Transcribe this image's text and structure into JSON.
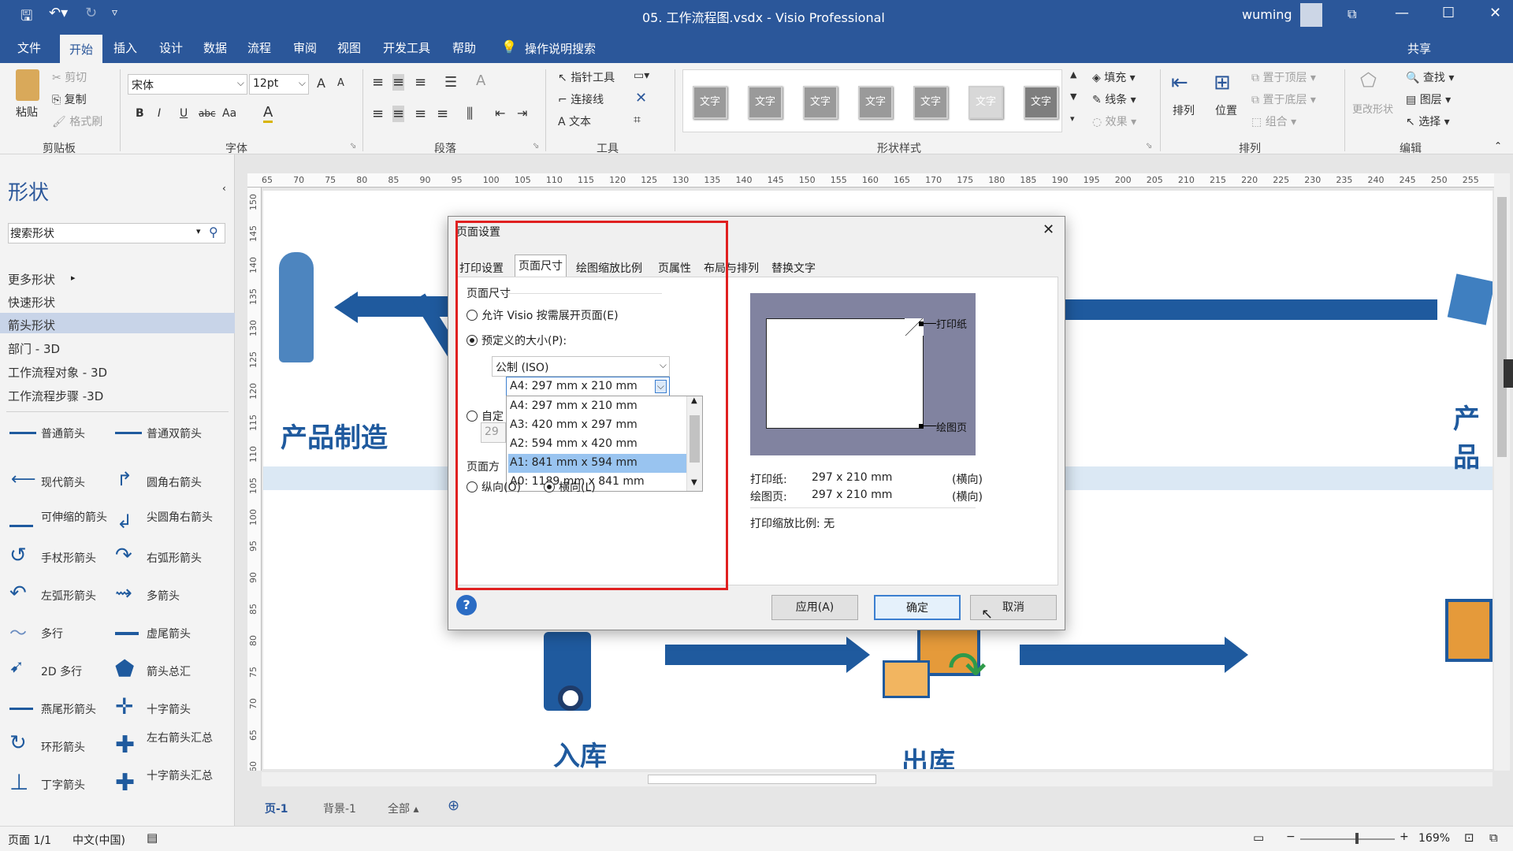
{
  "window": {
    "title": "05. 工作流程图.vsdx  -  Visio Professional",
    "user": "wuming",
    "share": "共享"
  },
  "tabs": [
    "文件",
    "开始",
    "插入",
    "设计",
    "数据",
    "流程",
    "审阅",
    "视图",
    "开发工具",
    "帮助"
  ],
  "tell_me": "操作说明搜索",
  "ribbon": {
    "clipboard": {
      "paste": "粘贴",
      "cut": "剪切",
      "copy": "复制",
      "format_painter": "格式刷",
      "label": "剪贴板"
    },
    "font": {
      "name": "宋体",
      "size": "12pt",
      "bold": "B",
      "italic": "I",
      "underline": "U",
      "strike": "abc",
      "case": "Aa",
      "grow": "A",
      "shrink": "A",
      "color": "A",
      "label": "字体"
    },
    "paragraph": {
      "label": "段落"
    },
    "tools": {
      "pointer": "指针工具",
      "connector": "连接线",
      "text": "文本",
      "label": "工具"
    },
    "styles": {
      "swatch": "文字",
      "fill": "填充",
      "line": "线条",
      "effect": "效果",
      "label": "形状样式"
    },
    "arrange": {
      "arrange": "排列",
      "position": "位置",
      "front": "置于顶层",
      "back": "置于底层",
      "group": "组合",
      "label": "排列"
    },
    "edit": {
      "change_shape": "更改形状",
      "find": "查找",
      "layers": "图层",
      "select": "选择",
      "label": "编辑"
    }
  },
  "shapes_panel": {
    "title": "形状",
    "search_placeholder": "搜索形状",
    "categories": [
      "更多形状",
      "快速形状",
      "箭头形状",
      "部门 - 3D",
      "工作流程对象 - 3D",
      "工作流程步骤 -3D"
    ],
    "items": [
      [
        "普通箭头",
        "普通双箭头"
      ],
      [
        "现代箭头",
        "圆角右箭头"
      ],
      [
        "可伸缩的箭头",
        "尖圆角右箭头"
      ],
      [
        "手杖形箭头",
        "右弧形箭头"
      ],
      [
        "左弧形箭头",
        "多箭头"
      ],
      [
        "多行",
        "虚尾箭头"
      ],
      [
        "2D 多行",
        "箭头总汇"
      ],
      [
        "燕尾形箭头",
        "十字箭头"
      ],
      [
        "环形箭头",
        "左右箭头汇总"
      ],
      [
        "丁字箭头",
        "十字箭头汇总"
      ]
    ]
  },
  "ruler_top": [
    "65",
    "70",
    "75",
    "80",
    "85",
    "90",
    "95",
    "100",
    "105",
    "110",
    "115",
    "120",
    "125",
    "130",
    "135",
    "140",
    "145",
    "150",
    "155",
    "160",
    "165",
    "170",
    "175",
    "180",
    "185",
    "190",
    "195",
    "200",
    "205",
    "210",
    "215",
    "220",
    "225",
    "230",
    "235",
    "240",
    "245",
    "250",
    "255"
  ],
  "ruler_left": [
    "150",
    "145",
    "140",
    "135",
    "130",
    "125",
    "120",
    "115",
    "110",
    "105",
    "100",
    "95",
    "90",
    "85",
    "80",
    "75",
    "70",
    "65",
    "60"
  ],
  "canvas": {
    "t1": "产品制造",
    "t2": "入库",
    "t3": "出库",
    "t4": "产品"
  },
  "dialog": {
    "title": "页面设置",
    "tabs": [
      "打印设置",
      "页面尺寸",
      "绘图缩放比例",
      "页属性",
      "布局与排列",
      "替换文字"
    ],
    "section": "页面尺寸",
    "opt_expand": "允许 Visio 按需展开页面(E)",
    "opt_predefined": "预定义的大小(P):",
    "standard": "公制 (ISO)",
    "size_selected": "A4:  297 mm x 210 mm",
    "sizes": [
      "A4:  297 mm x 210 mm",
      "A3:  420 mm x 297 mm",
      "A2:  594 mm x 420 mm",
      "A1:  841 mm x 594 mm",
      "A0:  1189 mm x 841 mm"
    ],
    "opt_custom": "自定",
    "custom_val": "29",
    "orient_label": "页面方",
    "portrait": "纵向(O)",
    "landscape": "横向(L)",
    "preview_print": "打印纸",
    "preview_draw": "绘图页",
    "info": [
      {
        "k": "打印纸:",
        "v": "297 x 210 mm",
        "o": "(横向)"
      },
      {
        "k": "绘图页:",
        "v": "297 x 210 mm",
        "o": "(横向)"
      }
    ],
    "scale": "打印缩放比例: 无",
    "apply": "应用(A)",
    "ok": "确定",
    "cancel": "取消",
    "help": "?",
    "close": "✕"
  },
  "pages": {
    "page": "页-1",
    "bg": "背景-1",
    "all": "全部 ▴"
  },
  "status": {
    "page": "页面 1/1",
    "lang": "中文(中国)",
    "zoom": "169%"
  }
}
